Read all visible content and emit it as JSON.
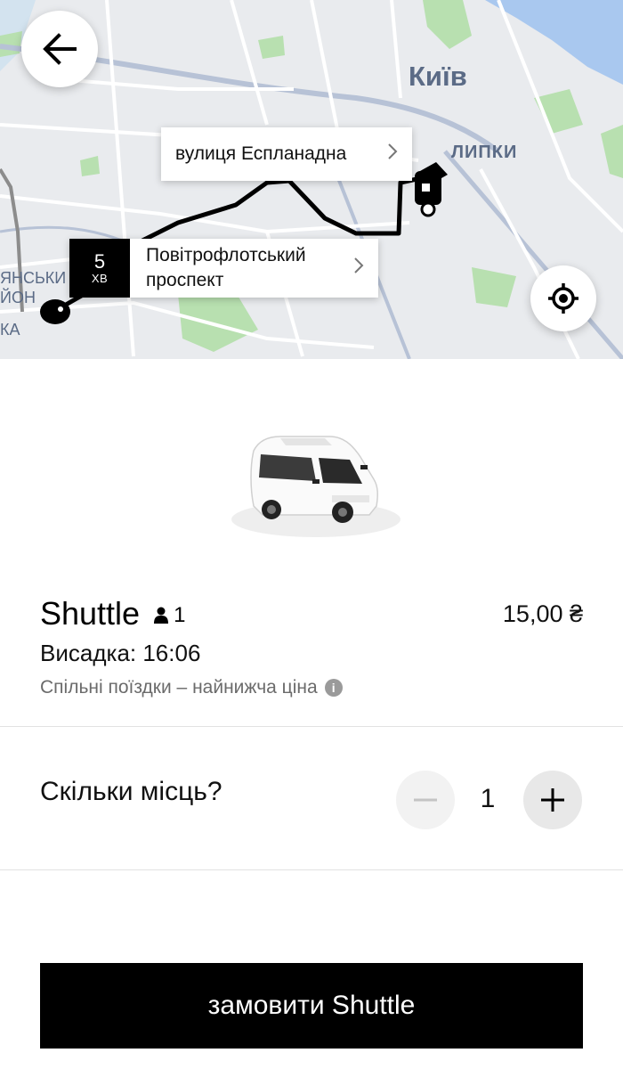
{
  "map": {
    "city_label": "Київ",
    "district_label": "ЛИПКИ",
    "edge_label_1": "ЯНСЬКИ",
    "edge_label_2": "ЙОН",
    "edge_label_3": "КА",
    "destination": {
      "label": "вулиця Еспланадна",
      "icon": "chevron-right-icon"
    },
    "pickup": {
      "eta_value": "5",
      "eta_unit": "ХВ",
      "label": "Повітрофлотський проспект",
      "icon": "chevron-right-icon"
    },
    "back_icon": "arrow-left-icon",
    "locate_icon": "crosshair-icon"
  },
  "ride": {
    "name": "Shuttle",
    "capacity_icon": "person-icon",
    "capacity": "1",
    "price": "15,00 ₴",
    "dropoff": "Висадка: 16:06",
    "description": "Спільні поїздки – найнижча ціна",
    "info_icon": "info-icon"
  },
  "seats": {
    "question": "Скільки місць?",
    "count": "1",
    "minus_icon": "minus-icon",
    "plus_icon": "plus-icon"
  },
  "order_button": {
    "label": "замовити Shuttle"
  },
  "colors": {
    "map_background": "#e9ebee",
    "water": "#a9c8ef",
    "park": "#b8e0b0",
    "route": "#000000",
    "button": "#000000"
  }
}
